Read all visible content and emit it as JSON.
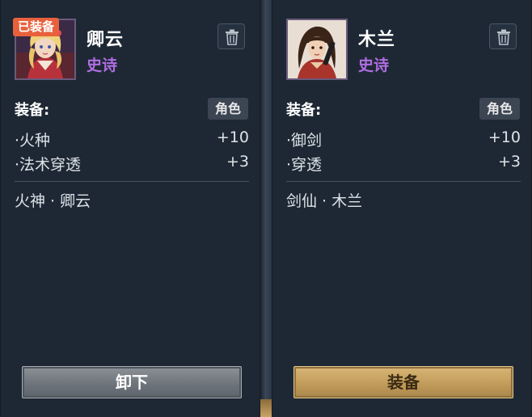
{
  "colors": {
    "badge": "#e8613c",
    "rarity_epic": "#b06de2",
    "panel_bg": "#1e2834",
    "button_gray": "#6f757c",
    "button_gold": "#c29c5b"
  },
  "cards": [
    {
      "badge": "已装备",
      "name": "卿云",
      "rarity": "史诗",
      "equip_label": "装备:",
      "role_tag": "角色",
      "stats": [
        {
          "name": "·火种",
          "value": "+10"
        },
        {
          "name": "·法术穿透",
          "value": "+3"
        }
      ],
      "description": "火神 · 卿云",
      "button": "卸下",
      "trash_icon": "trash-icon"
    },
    {
      "name": "木兰",
      "rarity": "史诗",
      "equip_label": "装备:",
      "role_tag": "角色",
      "stats": [
        {
          "name": "·御剑",
          "value": "+10"
        },
        {
          "name": "·穿透",
          "value": "+3"
        }
      ],
      "description": "剑仙 · 木兰",
      "button": "装备",
      "trash_icon": "trash-icon"
    }
  ]
}
